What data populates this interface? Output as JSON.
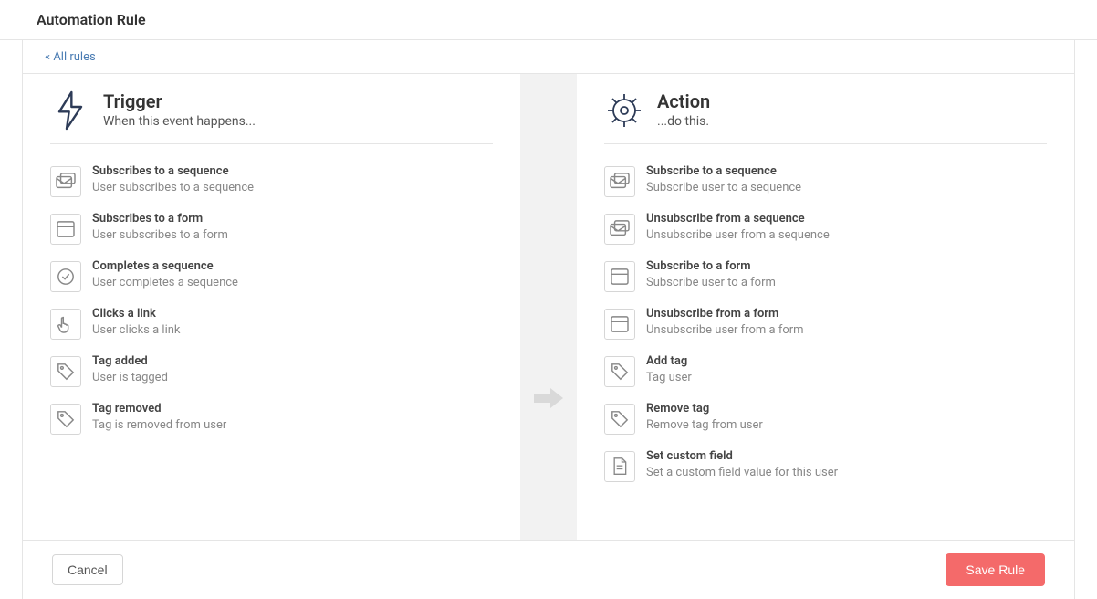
{
  "header": {
    "title": "Automation Rule"
  },
  "breadcrumb": {
    "all_rules": "« All rules"
  },
  "trigger": {
    "title": "Trigger",
    "subtitle": "When this event happens...",
    "options": [
      {
        "icon": "sequence",
        "title": "Subscribes to a sequence",
        "desc": "User subscribes to a sequence"
      },
      {
        "icon": "form",
        "title": "Subscribes to a form",
        "desc": "User subscribes to a form"
      },
      {
        "icon": "check",
        "title": "Completes a sequence",
        "desc": "User completes a sequence"
      },
      {
        "icon": "pointer",
        "title": "Clicks a link",
        "desc": "User clicks a link"
      },
      {
        "icon": "tag",
        "title": "Tag added",
        "desc": "User is tagged"
      },
      {
        "icon": "tag",
        "title": "Tag removed",
        "desc": "Tag is removed from user"
      }
    ]
  },
  "action": {
    "title": "Action",
    "subtitle": "...do this.",
    "options": [
      {
        "icon": "sequence",
        "title": "Subscribe to a sequence",
        "desc": "Subscribe user to a sequence"
      },
      {
        "icon": "sequence",
        "title": "Unsubscribe from a sequence",
        "desc": "Unsubscribe user from a sequence"
      },
      {
        "icon": "form",
        "title": "Subscribe to a form",
        "desc": "Subscribe user to a form"
      },
      {
        "icon": "form",
        "title": "Unsubscribe from a form",
        "desc": "Unsubscribe user from a form"
      },
      {
        "icon": "tag",
        "title": "Add tag",
        "desc": "Tag user"
      },
      {
        "icon": "tag",
        "title": "Remove tag",
        "desc": "Remove tag from user"
      },
      {
        "icon": "file",
        "title": "Set custom field",
        "desc": "Set a custom field value for this user"
      }
    ]
  },
  "footer": {
    "cancel": "Cancel",
    "save": "Save Rule"
  }
}
